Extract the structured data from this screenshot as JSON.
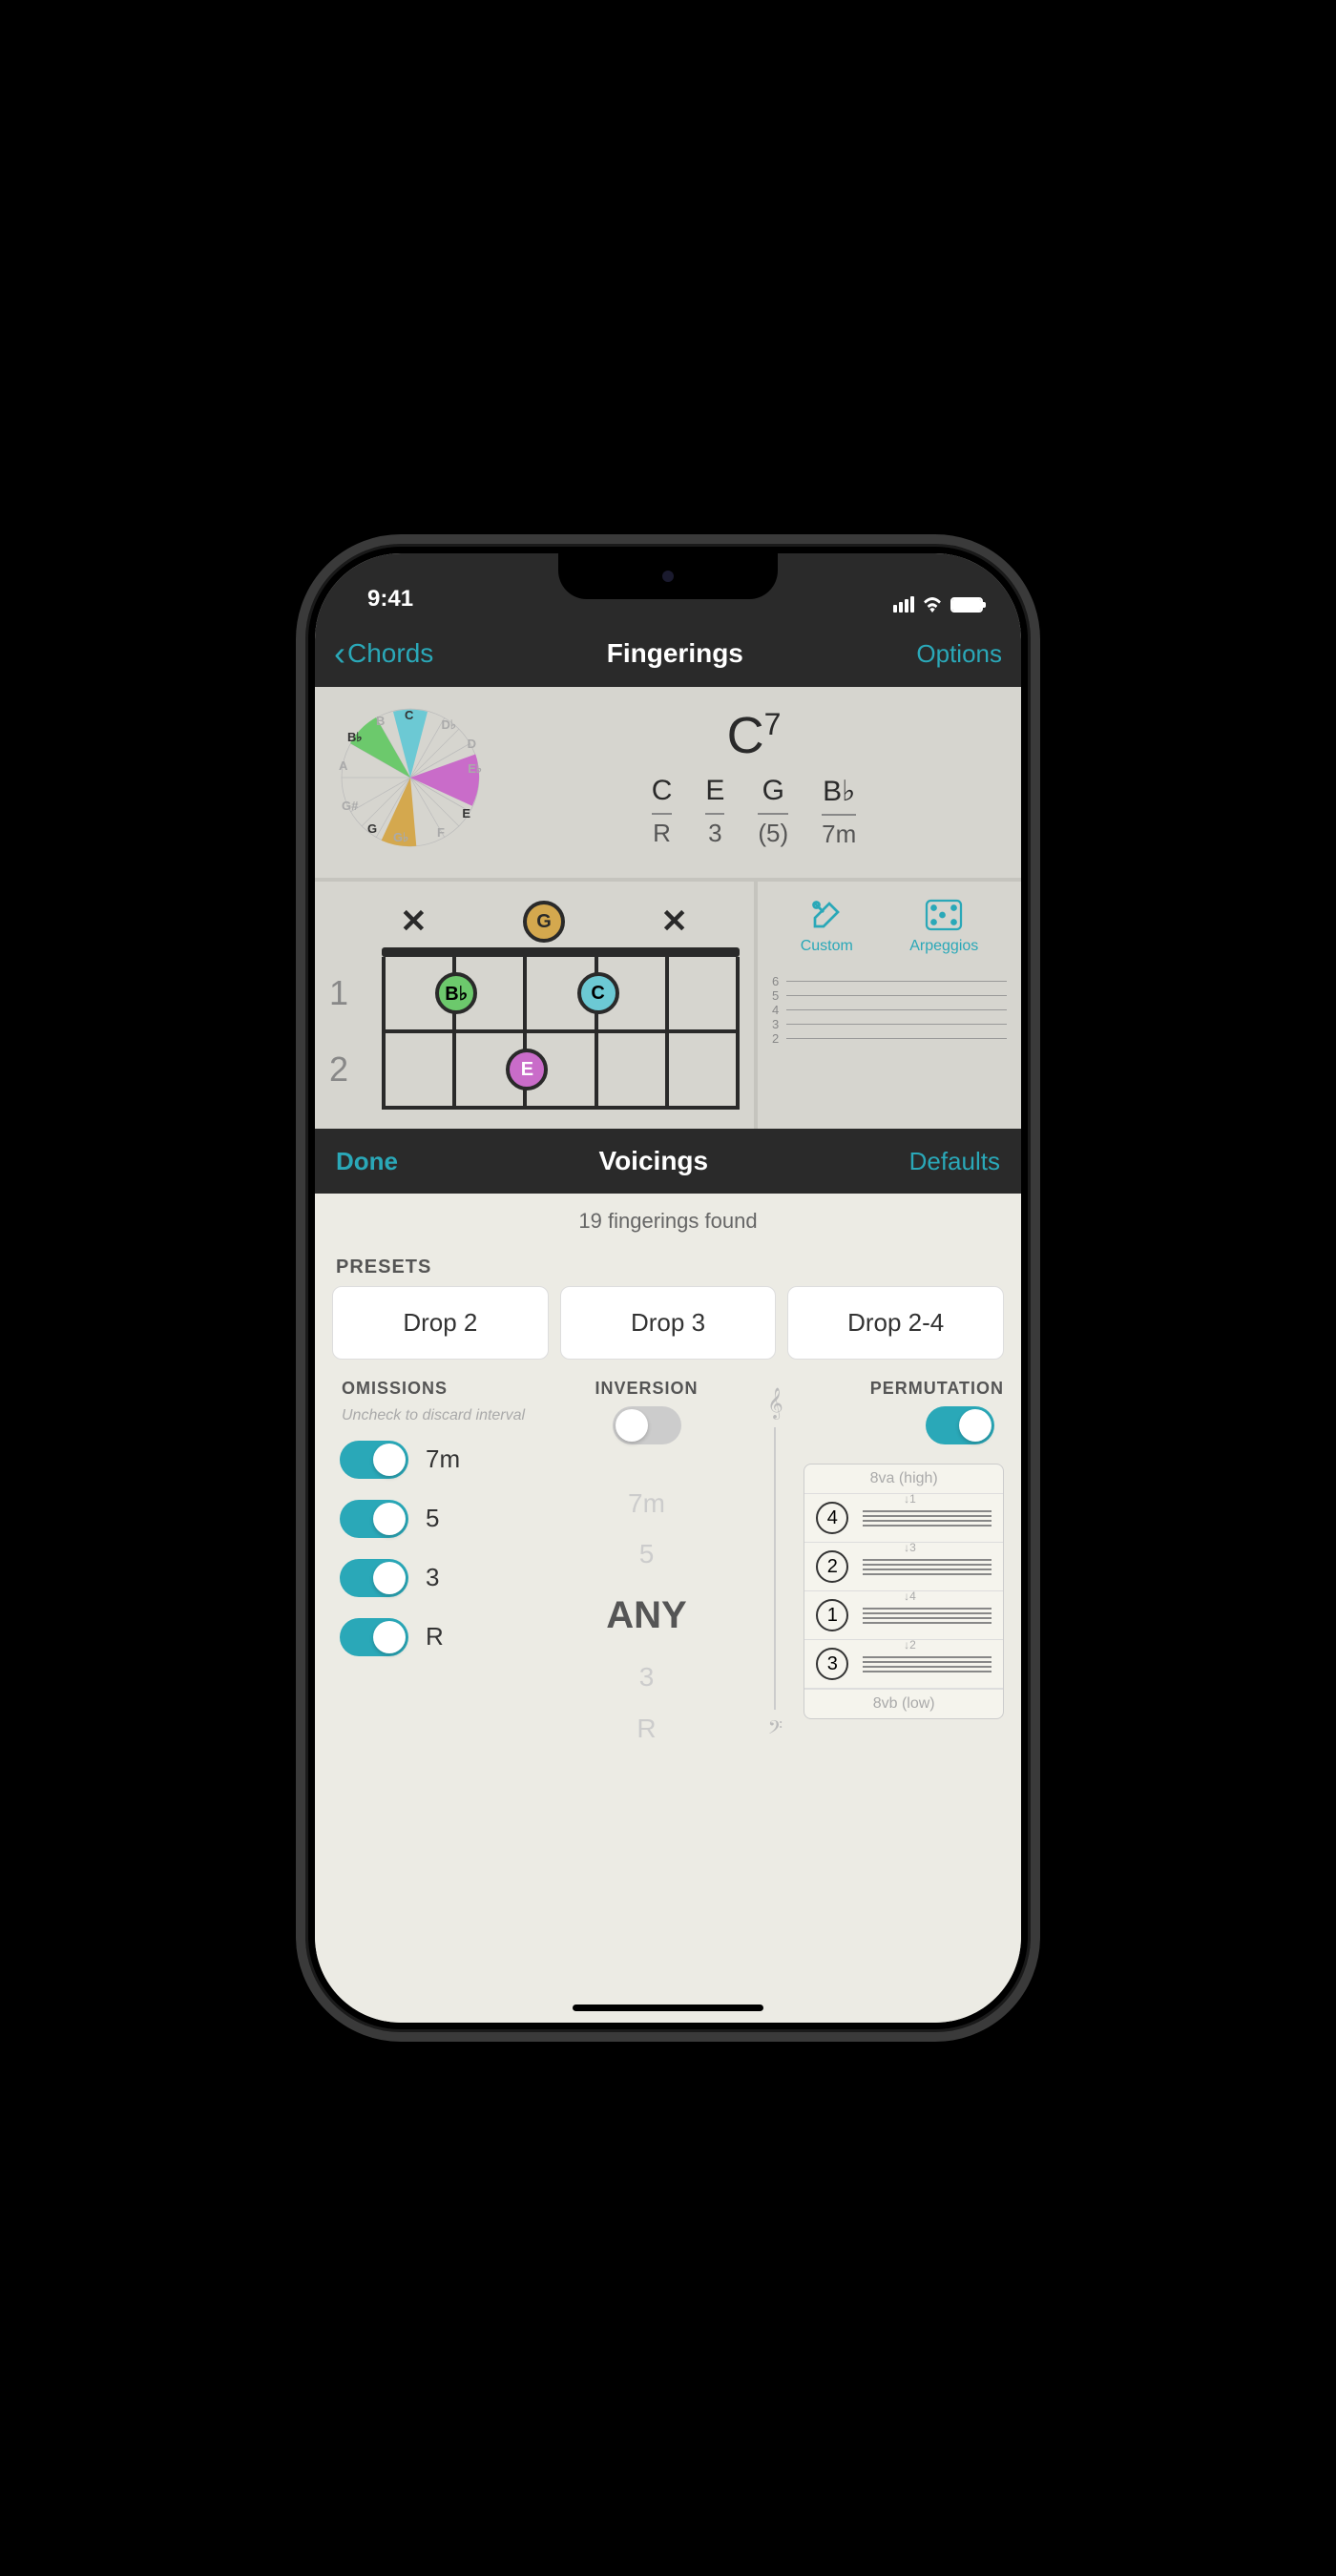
{
  "status": {
    "time": "9:41"
  },
  "nav": {
    "back": "Chords",
    "title": "Fingerings",
    "options": "Options"
  },
  "chord": {
    "name_root": "C",
    "name_sup": "7",
    "notes": [
      "C",
      "E",
      "G",
      "B♭"
    ],
    "intervals": [
      "R",
      "3",
      "(5)",
      "7m"
    ],
    "wheel_labels": {
      "c": "C",
      "db": "D♭",
      "d": "D",
      "eb": "E♭",
      "e": "E",
      "f": "F",
      "gb": "G♭",
      "g": "G",
      "gs": "G#",
      "a": "A",
      "bb": "B♭",
      "b": "B"
    }
  },
  "fretboard": {
    "fret_numbers": [
      "1",
      "2"
    ],
    "open_row": {
      "s1": "✕",
      "s3": "G",
      "s5": "✕"
    },
    "dots": {
      "r1s2": "B♭",
      "r1s4": "C",
      "r2s3": "E"
    }
  },
  "side": {
    "custom": "Custom",
    "arpeggios": "Arpeggios",
    "mini_labels": [
      "6",
      "5",
      "4",
      "3",
      "2"
    ]
  },
  "voicings": {
    "done": "Done",
    "title": "Voicings",
    "defaults": "Defaults"
  },
  "found": "19 fingerings found",
  "presets": {
    "label": "PRESETS",
    "items": [
      "Drop 2",
      "Drop 3",
      "Drop 2-4"
    ]
  },
  "omissions": {
    "label": "OMISSIONS",
    "hint": "Uncheck to discard interval",
    "items": [
      {
        "label": "7m",
        "on": true
      },
      {
        "label": "5",
        "on": true
      },
      {
        "label": "3",
        "on": true
      },
      {
        "label": "R",
        "on": true
      }
    ]
  },
  "inversion": {
    "label": "INVERSION",
    "on": false,
    "items": [
      "7m",
      "5",
      "ANY",
      "3",
      "R"
    ]
  },
  "permutation": {
    "label": "PERMUTATION",
    "on": true,
    "high": "8va (high)",
    "low": "8vb (low)",
    "rows": [
      {
        "n": "4",
        "arrow": "↓1"
      },
      {
        "n": "2",
        "arrow": "↓3"
      },
      {
        "n": "1",
        "arrow": "↓4"
      },
      {
        "n": "3",
        "arrow": "↓2"
      }
    ]
  }
}
